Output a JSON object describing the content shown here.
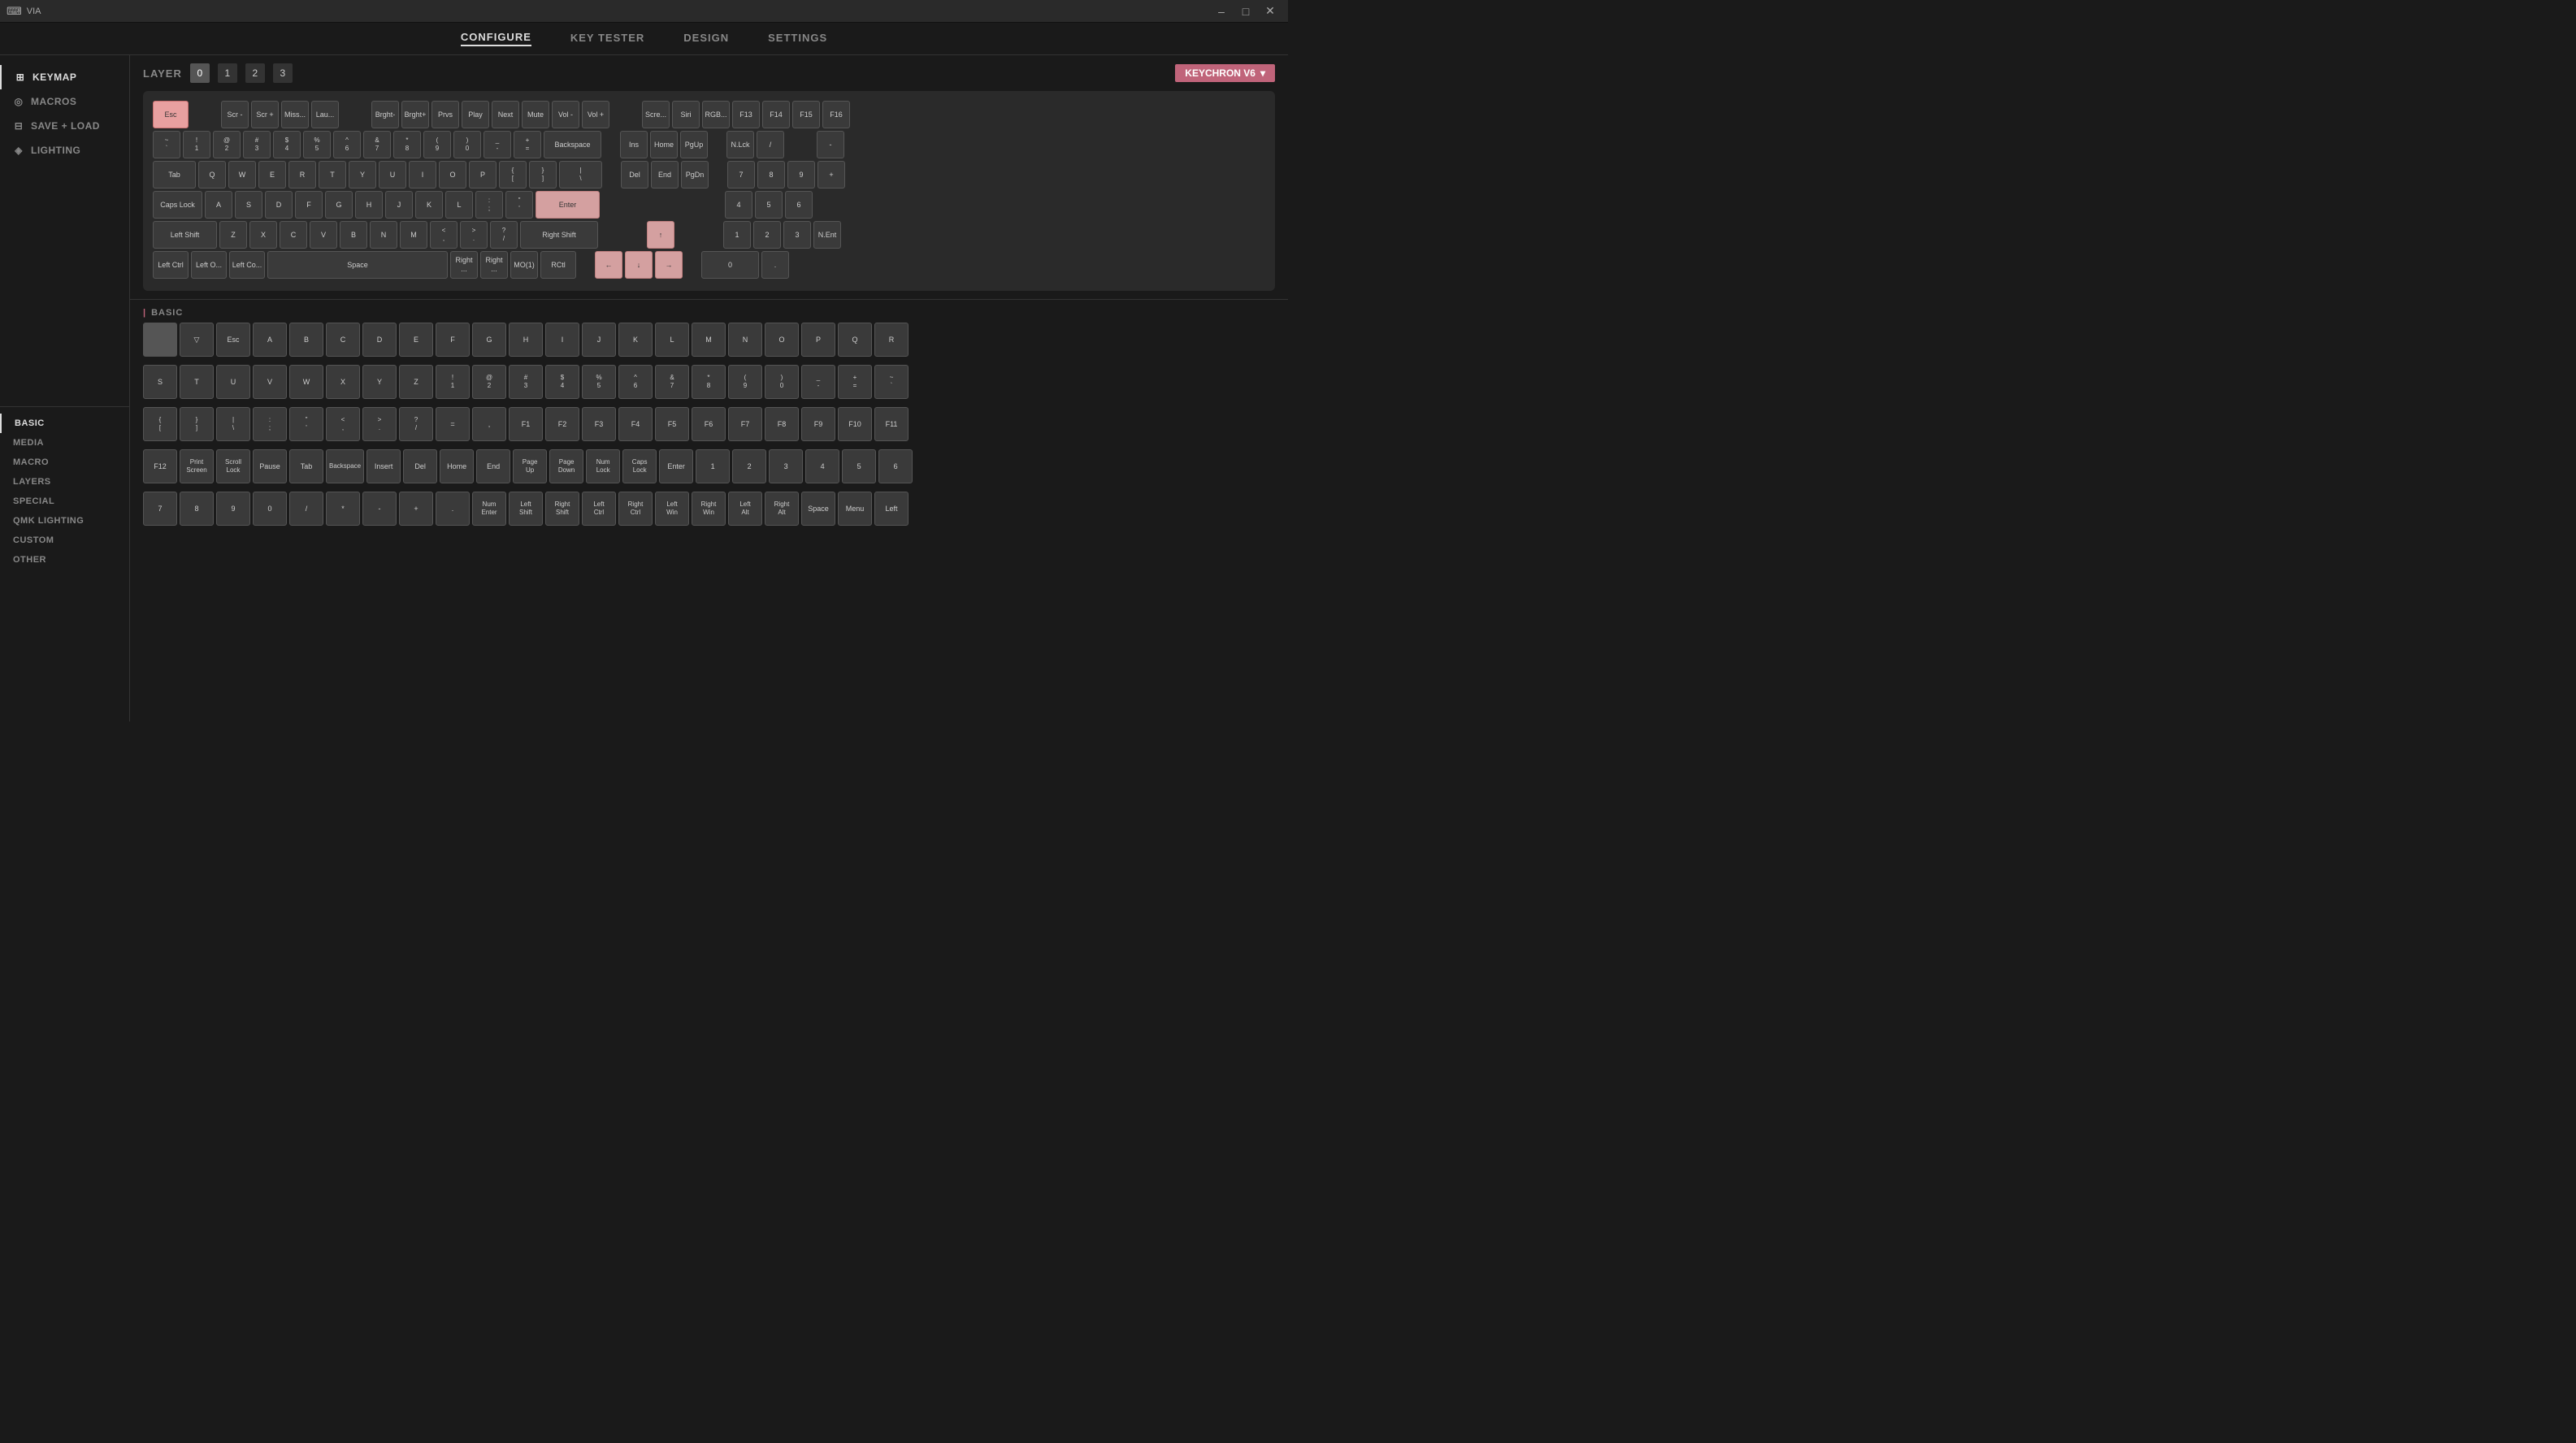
{
  "titlebar": {
    "title": "VIA",
    "minimize": "–",
    "maximize": "□",
    "close": "✕"
  },
  "topnav": {
    "items": [
      {
        "id": "configure",
        "label": "CONFIGURE",
        "active": true
      },
      {
        "id": "key-tester",
        "label": "KEY TESTER",
        "active": false
      },
      {
        "id": "design",
        "label": "DESIGN",
        "active": false
      },
      {
        "id": "settings",
        "label": "SETTINGS",
        "active": false
      }
    ]
  },
  "sidebar": {
    "items": [
      {
        "id": "keymap",
        "label": "KEYMAP",
        "icon": "⊞",
        "active": true
      },
      {
        "id": "macros",
        "label": "MACROS",
        "icon": "◎"
      },
      {
        "id": "save-load",
        "label": "SAVE + LOAD",
        "icon": "⊟"
      },
      {
        "id": "lighting",
        "label": "LIGHTING",
        "icon": "◈"
      }
    ]
  },
  "layer": {
    "label": "LAYER",
    "buttons": [
      "0",
      "1",
      "2",
      "3"
    ],
    "active": 0
  },
  "keyboard_select": {
    "label": "KEYCHRON V6",
    "arrow": "▾"
  },
  "keyboard": {
    "rows": [
      [
        {
          "label": "Esc",
          "width": "1-25u",
          "highlighted": true
        },
        {
          "label": "",
          "width": "1u",
          "empty": true
        },
        {
          "label": "Scr -",
          "width": "1u"
        },
        {
          "label": "Scr +",
          "width": "1u"
        },
        {
          "label": "Miss...",
          "width": "1u"
        },
        {
          "label": "Lau...",
          "width": "1u"
        },
        {
          "label": "",
          "width": "1u",
          "empty": true
        },
        {
          "label": "Brght-",
          "width": "1u"
        },
        {
          "label": "Brght+",
          "width": "1u"
        },
        {
          "label": "Prvs",
          "width": "1u"
        },
        {
          "label": "Play",
          "width": "1u"
        },
        {
          "label": "Next",
          "width": "1u"
        },
        {
          "label": "Mute",
          "width": "1u"
        },
        {
          "label": "Vol -",
          "width": "1u"
        },
        {
          "label": "Vol +",
          "width": "1u"
        },
        {
          "label": "",
          "width": "1u",
          "empty": true
        },
        {
          "label": "Scre...",
          "width": "1u"
        },
        {
          "label": "Siri",
          "width": "1u"
        },
        {
          "label": "RGB...",
          "width": "1u"
        },
        {
          "label": "F13",
          "width": "1u"
        },
        {
          "label": "F14",
          "width": "1u"
        },
        {
          "label": "F15",
          "width": "1u"
        },
        {
          "label": "F16",
          "width": "1u"
        }
      ],
      [
        {
          "label": "~\n`",
          "width": "1u"
        },
        {
          "label": "!\n1",
          "width": "1u"
        },
        {
          "label": "@\n2",
          "width": "1u"
        },
        {
          "label": "#\n3",
          "width": "1u"
        },
        {
          "label": "$\n4",
          "width": "1u"
        },
        {
          "label": "%\n5",
          "width": "1u"
        },
        {
          "label": "^\n6",
          "width": "1u"
        },
        {
          "label": "&\n7",
          "width": "1u"
        },
        {
          "label": "*\n8",
          "width": "1u"
        },
        {
          "label": "(\n9",
          "width": "1u"
        },
        {
          "label": ")\n0",
          "width": "1u"
        },
        {
          "label": "_\n-",
          "width": "1u"
        },
        {
          "label": "+\n=",
          "width": "1u"
        },
        {
          "label": "Backspace",
          "width": "2u"
        },
        {
          "label": "",
          "width": "0.5u",
          "empty": true
        },
        {
          "label": "Ins",
          "width": "1u"
        },
        {
          "label": "Home",
          "width": "1u"
        },
        {
          "label": "PgUp",
          "width": "1u"
        },
        {
          "label": "",
          "width": "0.5u",
          "empty": true
        },
        {
          "label": "N.Lck",
          "width": "1u"
        },
        {
          "label": "/",
          "width": "1u"
        },
        {
          "label": "",
          "width": "1u",
          "empty": true
        },
        {
          "label": "-",
          "width": "1u"
        }
      ],
      [
        {
          "label": "Tab",
          "width": "1-5u"
        },
        {
          "label": "Q",
          "width": "1u"
        },
        {
          "label": "W",
          "width": "1u"
        },
        {
          "label": "E",
          "width": "1u"
        },
        {
          "label": "R",
          "width": "1u"
        },
        {
          "label": "T",
          "width": "1u"
        },
        {
          "label": "Y",
          "width": "1u"
        },
        {
          "label": "U",
          "width": "1u"
        },
        {
          "label": "I",
          "width": "1u"
        },
        {
          "label": "O",
          "width": "1u"
        },
        {
          "label": "P",
          "width": "1u"
        },
        {
          "label": "{\n[",
          "width": "1u"
        },
        {
          "label": "}\n]",
          "width": "1u"
        },
        {
          "label": "|\n\\",
          "width": "1-5u"
        },
        {
          "label": "",
          "width": "0.5u",
          "empty": true
        },
        {
          "label": "Del",
          "width": "1u"
        },
        {
          "label": "End",
          "width": "1u"
        },
        {
          "label": "PgDn",
          "width": "1u"
        },
        {
          "label": "",
          "width": "0.5u",
          "empty": true
        },
        {
          "label": "7",
          "width": "1u"
        },
        {
          "label": "8",
          "width": "1u"
        },
        {
          "label": "9",
          "width": "1u"
        },
        {
          "label": "+",
          "width": "1u"
        }
      ],
      [
        {
          "label": "Caps Lock",
          "width": "1-75u"
        },
        {
          "label": "A",
          "width": "1u"
        },
        {
          "label": "S",
          "width": "1u"
        },
        {
          "label": "D",
          "width": "1u"
        },
        {
          "label": "F",
          "width": "1u"
        },
        {
          "label": "G",
          "width": "1u"
        },
        {
          "label": "H",
          "width": "1u"
        },
        {
          "label": "J",
          "width": "1u"
        },
        {
          "label": "K",
          "width": "1u"
        },
        {
          "label": "L",
          "width": "1u"
        },
        {
          "label": ":\n;",
          "width": "1u"
        },
        {
          "label": "\"\n'",
          "width": "1u"
        },
        {
          "label": "Enter",
          "width": "2-25u",
          "highlighted": true
        },
        {
          "label": "",
          "width": "0.5u",
          "empty": true
        },
        {
          "label": "",
          "width": "1u",
          "empty": true
        },
        {
          "label": "",
          "width": "1u",
          "empty": true
        },
        {
          "label": "",
          "width": "1u",
          "empty": true
        },
        {
          "label": "",
          "width": "0.5u",
          "empty": true
        },
        {
          "label": "4",
          "width": "1u"
        },
        {
          "label": "5",
          "width": "1u"
        },
        {
          "label": "6",
          "width": "1u"
        }
      ],
      [
        {
          "label": "Left Shift",
          "width": "2-25u"
        },
        {
          "label": "Z",
          "width": "1u"
        },
        {
          "label": "X",
          "width": "1u"
        },
        {
          "label": "C",
          "width": "1u"
        },
        {
          "label": "V",
          "width": "1u"
        },
        {
          "label": "B",
          "width": "1u"
        },
        {
          "label": "N",
          "width": "1u"
        },
        {
          "label": "M",
          "width": "1u"
        },
        {
          "label": "<\n,",
          "width": "1u"
        },
        {
          "label": ">\n.",
          "width": "1u"
        },
        {
          "label": "?\n/",
          "width": "1u"
        },
        {
          "label": "Right Shift",
          "width": "2-75u"
        },
        {
          "label": "",
          "width": "0.5u",
          "empty": true
        },
        {
          "label": "",
          "width": "1u",
          "empty": true
        },
        {
          "label": "↑",
          "width": "1u",
          "pink": true
        },
        {
          "label": "",
          "width": "1u",
          "empty": true
        },
        {
          "label": "",
          "width": "0.5u",
          "empty": true
        },
        {
          "label": "1",
          "width": "1u"
        },
        {
          "label": "2",
          "width": "1u"
        },
        {
          "label": "3",
          "width": "1u"
        },
        {
          "label": "N.Ent",
          "width": "1u"
        }
      ],
      [
        {
          "label": "Left Ctrl",
          "width": "1-25u"
        },
        {
          "label": "Left O...",
          "width": "1-25u"
        },
        {
          "label": "Left Co...",
          "width": "1-25u"
        },
        {
          "label": "Space",
          "width": "6-25u"
        },
        {
          "label": "Right ...",
          "width": "1u"
        },
        {
          "label": "Right ...",
          "width": "1u"
        },
        {
          "label": "MO(1)",
          "width": "1u"
        },
        {
          "label": "RCtl",
          "width": "1-25u"
        },
        {
          "label": "",
          "width": "0.5u",
          "empty": true
        },
        {
          "label": "←",
          "width": "1u",
          "pink": true
        },
        {
          "label": "↓",
          "width": "1u",
          "pink": true
        },
        {
          "label": "→",
          "width": "1u",
          "pink": true
        },
        {
          "label": "",
          "width": "0.5u",
          "empty": true
        },
        {
          "label": "0",
          "width": "2u"
        },
        {
          "label": ".",
          "width": "1u"
        }
      ]
    ]
  },
  "bottom_sidebar": {
    "items": [
      {
        "id": "basic",
        "label": "BASIC",
        "active": true
      },
      {
        "id": "media",
        "label": "MEDIA"
      },
      {
        "id": "macro",
        "label": "MACRO"
      },
      {
        "id": "layers",
        "label": "LAYERS"
      },
      {
        "id": "special",
        "label": "SPECIAL"
      },
      {
        "id": "qmk-lighting",
        "label": "QMK LIGHTING"
      },
      {
        "id": "custom",
        "label": "CUSTOM"
      },
      {
        "id": "other",
        "label": "OTHER"
      }
    ]
  },
  "picker": {
    "label": "BASIC",
    "rows": [
      [
        {
          "label": "",
          "empty": true
        },
        {
          "label": "▽",
          "sub": ""
        },
        {
          "label": "Esc"
        },
        {
          "label": "A"
        },
        {
          "label": "B"
        },
        {
          "label": "C"
        },
        {
          "label": "D"
        },
        {
          "label": "E"
        },
        {
          "label": "F"
        },
        {
          "label": "G"
        },
        {
          "label": "H"
        },
        {
          "label": "I"
        },
        {
          "label": "J"
        },
        {
          "label": "K"
        },
        {
          "label": "L"
        },
        {
          "label": "M"
        },
        {
          "label": "N"
        },
        {
          "label": "O"
        },
        {
          "label": "P"
        },
        {
          "label": "Q"
        },
        {
          "label": "R"
        }
      ],
      [
        {
          "label": "S"
        },
        {
          "label": "T"
        },
        {
          "label": "U"
        },
        {
          "label": "V"
        },
        {
          "label": "W"
        },
        {
          "label": "X"
        },
        {
          "label": "Y"
        },
        {
          "label": "Z"
        },
        {
          "label": "!\n1"
        },
        {
          "label": "@\n2"
        },
        {
          "label": "#\n3"
        },
        {
          "label": "$\n4"
        },
        {
          "label": "%\n5"
        },
        {
          "label": "^\n6"
        },
        {
          "label": "&\n7"
        },
        {
          "label": "*\n8"
        },
        {
          "label": "(\n9"
        },
        {
          "label": ")\n0"
        },
        {
          "label": "_\n-"
        },
        {
          "label": "+\n="
        },
        {
          "label": "~\n`"
        }
      ],
      [
        {
          "label": "{\n["
        },
        {
          "label": "}\n]"
        },
        {
          "label": "|\n\\"
        },
        {
          "label": ":\n;"
        },
        {
          "label": "\"\n'"
        },
        {
          "label": "<\n,"
        },
        {
          "label": ">\n."
        },
        {
          "label": "?\n/"
        },
        {
          "label": "="
        },
        {
          "label": ","
        },
        {
          "label": "F1"
        },
        {
          "label": "F2"
        },
        {
          "label": "F3"
        },
        {
          "label": "F4"
        },
        {
          "label": "F5"
        },
        {
          "label": "F6"
        },
        {
          "label": "F7"
        },
        {
          "label": "F8"
        },
        {
          "label": "F9"
        },
        {
          "label": "F10"
        },
        {
          "label": "F11"
        }
      ],
      [
        {
          "label": "F12"
        },
        {
          "label": "Print\nScreen"
        },
        {
          "label": "Scroll\nLock"
        },
        {
          "label": "Pause"
        },
        {
          "label": "Tab"
        },
        {
          "label": "Backspace"
        },
        {
          "label": "Insert"
        },
        {
          "label": "Del"
        },
        {
          "label": "Home"
        },
        {
          "label": "End"
        },
        {
          "label": "Page\nUp"
        },
        {
          "label": "Page\nDown"
        },
        {
          "label": "Num\nLock"
        },
        {
          "label": "Caps\nLock"
        },
        {
          "label": "Enter"
        },
        {
          "label": "1"
        },
        {
          "label": "2"
        },
        {
          "label": "3"
        },
        {
          "label": "4"
        },
        {
          "label": "5"
        },
        {
          "label": "6"
        }
      ],
      [
        {
          "label": "7"
        },
        {
          "label": "8"
        },
        {
          "label": "9"
        },
        {
          "label": "0"
        },
        {
          "label": "/"
        },
        {
          "label": "*"
        },
        {
          "label": "-"
        },
        {
          "label": "+"
        },
        {
          "label": "."
        },
        {
          "label": "Num\nEnter"
        },
        {
          "label": "Left\nShift"
        },
        {
          "label": "Right\nShift"
        },
        {
          "label": "Left\nCtrl"
        },
        {
          "label": "Right\nCtrl"
        },
        {
          "label": "Left\nWin"
        },
        {
          "label": "Right\nWin"
        },
        {
          "label": "Left\nAlt"
        },
        {
          "label": "Right\nAlt"
        },
        {
          "label": "Space"
        },
        {
          "label": "Menu"
        },
        {
          "label": "Left"
        }
      ]
    ]
  }
}
